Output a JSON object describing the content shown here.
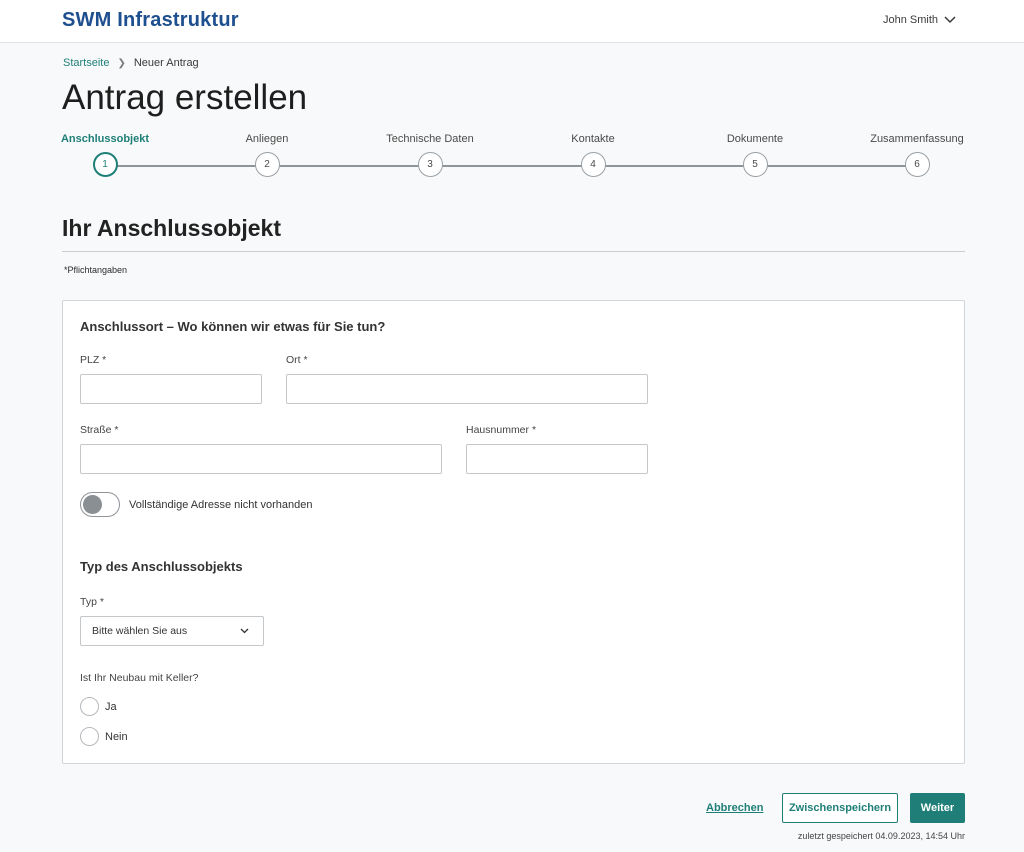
{
  "header": {
    "logo": "SWM Infrastruktur",
    "user_name": "John Smith"
  },
  "breadcrumb": {
    "home": "Startseite",
    "current": "Neuer Antrag"
  },
  "page_title": "Antrag erstellen",
  "stepper": {
    "active_step": 1,
    "steps": [
      {
        "label": "Anschlussobjekt",
        "number": "1"
      },
      {
        "label": "Anliegen",
        "number": "2"
      },
      {
        "label": "Technische Daten",
        "number": "3"
      },
      {
        "label": "Kontakte",
        "number": "4"
      },
      {
        "label": "Dokumente",
        "number": "5"
      },
      {
        "label": "Zusammenfassung",
        "number": "6"
      }
    ]
  },
  "section": {
    "title": "Ihr Anschlussobjekt",
    "required_note": "*Pflichtangaben"
  },
  "form": {
    "card_title": "Anschlussort – Wo können wir etwas für Sie tun?",
    "plz_label": "PLZ *",
    "plz_value": "",
    "ort_label": "Ort *",
    "ort_value": "",
    "strasse_label": "Straße *",
    "strasse_value": "",
    "hausnummer_label": "Hausnummer *",
    "hausnummer_value": "",
    "toggle_label": "Vollständige Adresse nicht vorhanden",
    "toggle_on": false,
    "type_heading": "Typ des Anschlussobjekts",
    "typ_label": "Typ *",
    "typ_selected": "Bitte wählen Sie aus",
    "keller_question": "Ist Ihr Neubau mit Keller?",
    "radio_yes": "Ja",
    "radio_no": "Nein"
  },
  "actions": {
    "cancel": "Abbrechen",
    "save_draft": "Zwischenspeichern",
    "next": "Weiter",
    "last_saved": "zuletzt gespeichert 04.09.2023, 14:54 Uhr"
  },
  "colors": {
    "brand_blue": "#1e4f8f",
    "accent_teal": "#1f7f78",
    "background": "#f8f9fa"
  }
}
